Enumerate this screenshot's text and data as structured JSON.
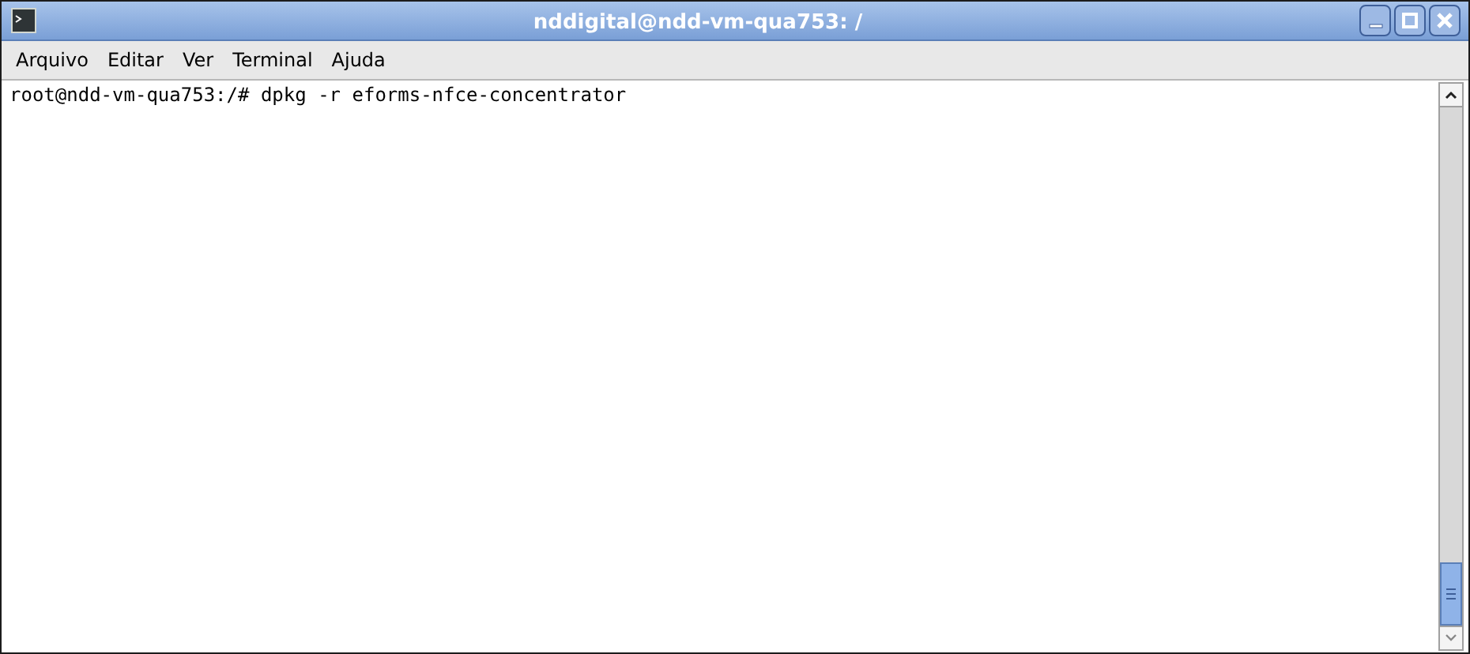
{
  "window": {
    "title": "nddigital@ndd-vm-qua753: /"
  },
  "menu": [
    "Arquivo",
    "Editar",
    "Ver",
    "Terminal",
    "Ajuda"
  ],
  "terminal": {
    "lines": [
      "root@ndd-vm-qua753:/# dpkg -r eforms-nfce-concentrator"
    ]
  }
}
